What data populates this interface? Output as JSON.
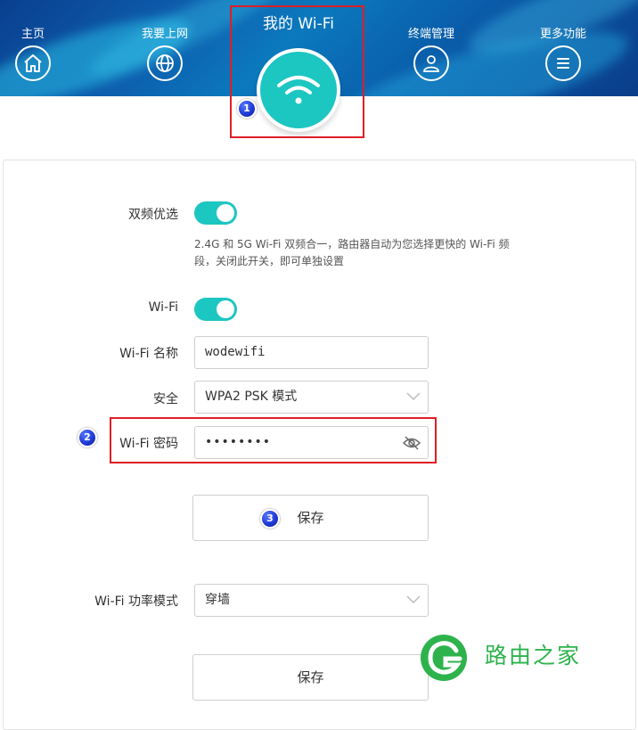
{
  "nav": {
    "items": [
      {
        "label": "主页",
        "icon": "home-icon"
      },
      {
        "label": "我要上网",
        "icon": "globe-icon"
      },
      {
        "label": "我的 Wi-Fi",
        "icon": "wifi-icon"
      },
      {
        "label": "终端管理",
        "icon": "user-icon"
      },
      {
        "label": "更多功能",
        "icon": "menu-icon"
      }
    ]
  },
  "markers": [
    "1",
    "2",
    "3"
  ],
  "settings": {
    "dual_band": {
      "label": "双频优选",
      "enabled": true,
      "description": "2.4G 和 5G Wi-Fi 双频合一，路由器自动为您选择更快的 Wi-Fi 频段，关闭此开关，即可单独设置"
    },
    "wifi": {
      "label": "Wi-Fi",
      "enabled": true
    },
    "ssid": {
      "label": "Wi-Fi 名称",
      "value": "wodewifi"
    },
    "security": {
      "label": "安全",
      "value": "WPA2 PSK 模式"
    },
    "password": {
      "label": "Wi-Fi 密码",
      "value": "••••••••"
    },
    "save_label": "保存",
    "power": {
      "label": "Wi-Fi 功率模式",
      "value": "穿墙"
    },
    "save2_label": "保存"
  },
  "watermark": {
    "text": "路由之家"
  },
  "colors": {
    "accent": "#1cc6c1",
    "header": "#0d5fae",
    "highlight": "#e01e24",
    "watermark": "#2eb34c"
  }
}
